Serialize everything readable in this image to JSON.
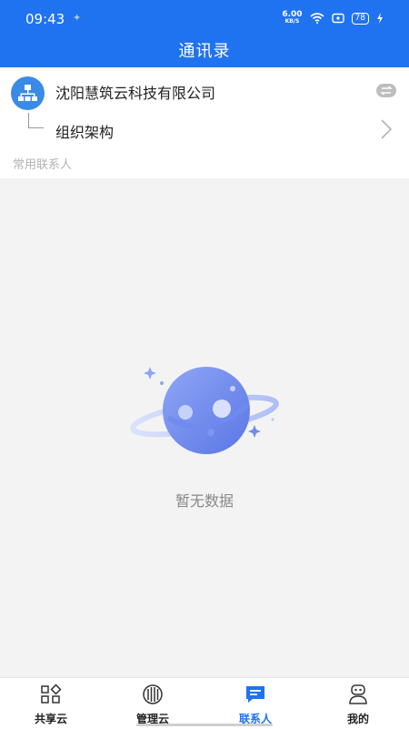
{
  "status_bar": {
    "time": "09:43",
    "net_speed_value": "6.00",
    "net_speed_unit": "KB/S",
    "battery": "78"
  },
  "header": {
    "title": "通讯录"
  },
  "company": {
    "name": "沈阳慧筑云科技有限公司"
  },
  "org": {
    "label": "组织架构"
  },
  "frequent_contacts": {
    "label": "常用联系人"
  },
  "empty_state": {
    "text": "暂无数据"
  },
  "tabbar": {
    "tabs": [
      {
        "label": "共享云",
        "icon": "shared-cloud-icon"
      },
      {
        "label": "管理云",
        "icon": "manage-cloud-icon"
      },
      {
        "label": "联系人",
        "icon": "contacts-icon",
        "active": true
      },
      {
        "label": "我的",
        "icon": "profile-icon"
      }
    ]
  },
  "colors": {
    "primary": "#1f73f1",
    "background": "#f3f3f3",
    "muted_text": "#888888"
  }
}
